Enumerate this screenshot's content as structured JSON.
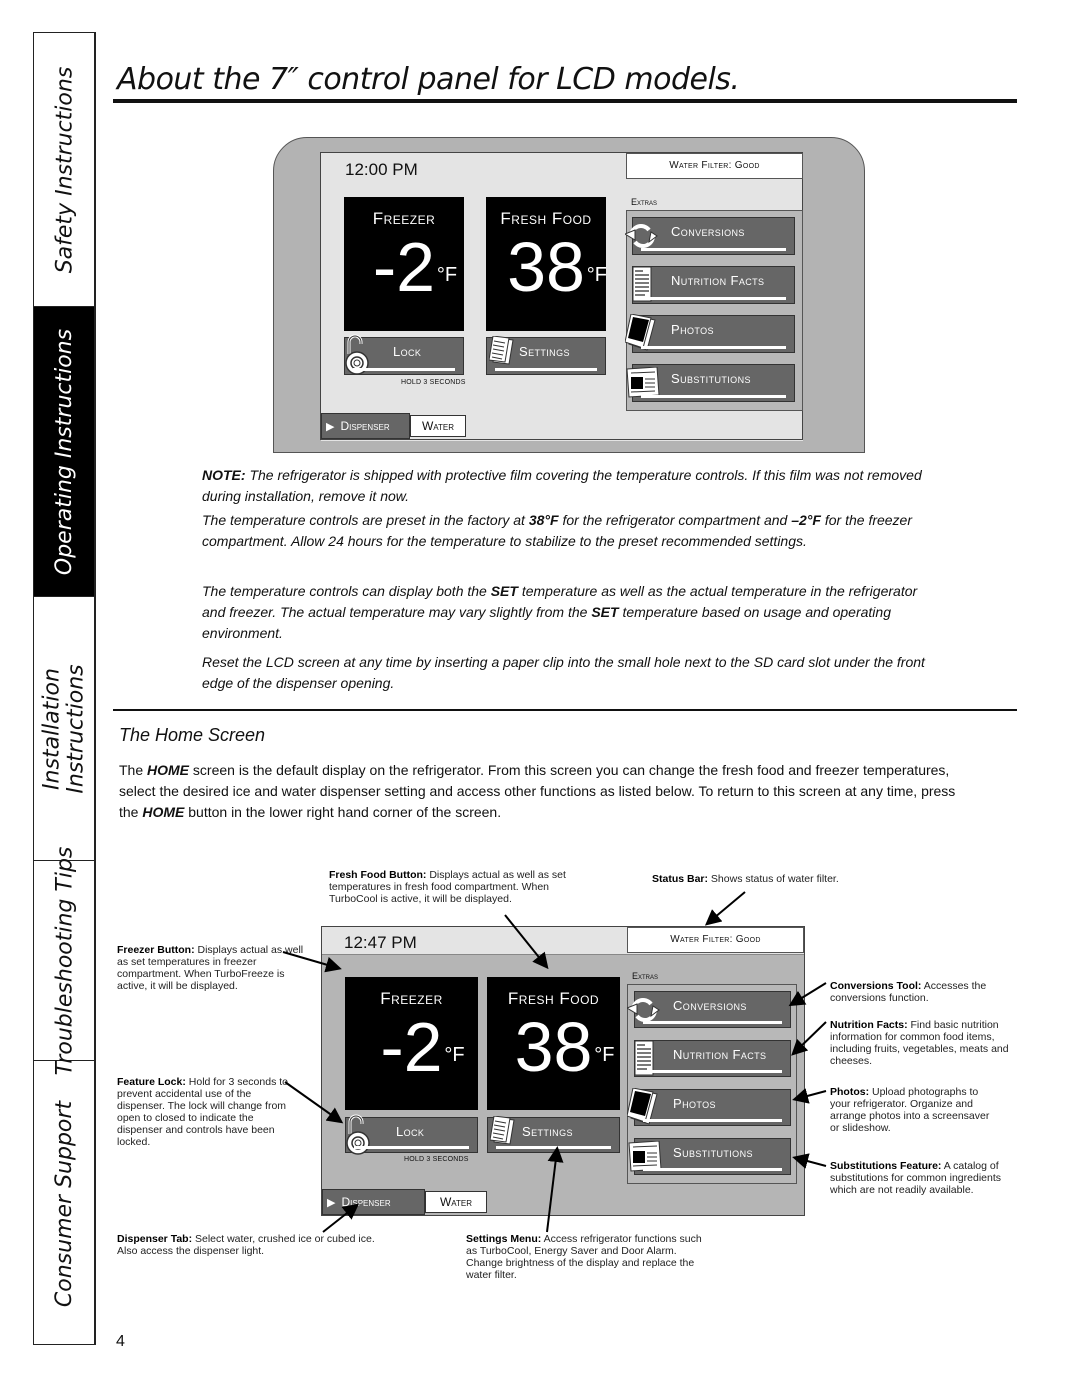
{
  "sidebar": {
    "tabs": [
      {
        "label": "Safety Instructions",
        "active": false
      },
      {
        "label": "Operating Instructions",
        "active": true
      },
      {
        "label_line1": "Installation",
        "label_line2": "Instructions",
        "active": false
      },
      {
        "label": "Troubleshooting Tips",
        "active": false
      },
      {
        "label": "Consumer Support",
        "active": false
      }
    ]
  },
  "page": {
    "title": "About the 7″ control panel for LCD models.",
    "page_number": "4"
  },
  "panel_top": {
    "time": "12:00 PM",
    "water_filter_status": "Water Filter: Good",
    "freezer": {
      "label": "Freezer",
      "value": "-2",
      "unit": "°F"
    },
    "fresh_food": {
      "label": "Fresh Food",
      "value": "38",
      "unit": "°F"
    },
    "lock_label": "Lock",
    "lock_hint": "HOLD 3 SECONDS",
    "settings_label": "Settings",
    "extras_label": "Extras",
    "extras": [
      {
        "label": "Conversions",
        "icon": "refresh-arrows-icon"
      },
      {
        "label": "Nutrition Facts",
        "icon": "nutrition-label-icon"
      },
      {
        "label": "Photos",
        "icon": "photos-icon"
      },
      {
        "label": "Substitutions",
        "icon": "document-icon"
      }
    ],
    "dispenser_label": "Dispenser",
    "dispenser_value": "Water"
  },
  "notes": {
    "note_prefix": "NOTE:",
    "note_text": " The refrigerator is shipped with protective film covering the temperature controls. If this film was not removed during installation, remove it now.",
    "preset_1": "The temperature controls are preset in the factory at ",
    "preset_fresh": "38°F",
    "preset_2": " for the refrigerator compartment and ",
    "preset_freezer": "–2°F",
    "preset_3": " for the freezer compartment. Allow 24 hours for the temperature to stabilize to the preset recommended settings.",
    "set_1": "The temperature controls can display both the ",
    "set_bold": "SET",
    "set_2": " temperature as well as the actual temperature in the refrigerator and freezer. The actual temperature may vary slightly from the ",
    "set_3": " temperature based on usage and operating environment.",
    "reset": "Reset the LCD screen at any time by inserting a paper clip into the small hole next to the SD card slot under the front edge of the dispenser opening."
  },
  "home_screen": {
    "heading": "The Home Screen",
    "intro_1": "The ",
    "home_bold": "HOME",
    "intro_2": " screen is the default display on the refrigerator. From this screen you can change the fresh food and freezer temperatures, select the desired ice and water dispenser setting and access other functions as listed below. To return to this screen at any time, press the ",
    "intro_3": " button in the lower right hand corner of the screen."
  },
  "panel_bottom": {
    "time": "12:47 PM",
    "water_filter_status": "Water Filter: Good",
    "freezer": {
      "label": "Freezer",
      "value": "-2",
      "unit": "°F"
    },
    "fresh_food": {
      "label": "Fresh Food",
      "value": "38",
      "unit": "°F"
    },
    "lock_label": "Lock",
    "lock_hint": "HOLD 3 SECONDS",
    "settings_label": "Settings",
    "extras_label": "Extras",
    "extras": [
      {
        "label": "Conversions"
      },
      {
        "label": "Nutrition Facts"
      },
      {
        "label": "Photos"
      },
      {
        "label": "Substitutions"
      }
    ],
    "dispenser_label": "Dispenser",
    "dispenser_value": "Water"
  },
  "callouts": {
    "fresh_food": {
      "title": "Fresh Food Button:",
      "text": " Displays actual as well as set temperatures in fresh food compartment. When TurboCool is active, it will be displayed."
    },
    "status_bar": {
      "title": "Status Bar:",
      "text": " Shows status of water filter."
    },
    "freezer": {
      "title": "Freezer Button:",
      "text": " Displays actual as well as set temperatures in freezer compartment. When TurboFreeze is active, it will be displayed."
    },
    "feature_lock": {
      "title": "Feature Lock:",
      "text": " Hold for 3 seconds to prevent accidental use of the dispenser. The lock will change from open to closed to indicate the dispenser and controls have been locked."
    },
    "dispenser_tab": {
      "title": "Dispenser Tab:",
      "text": " Select water, crushed ice or cubed ice. Also access the dispenser light."
    },
    "settings_menu": {
      "title": "Settings Menu:",
      "text": " Access refrigerator functions such as TurboCool, Energy Saver and Door Alarm. Change brightness of the display and replace the water filter."
    },
    "conversions": {
      "title": "Conversions Tool:",
      "text": " Accesses the conversions function."
    },
    "nutrition": {
      "title": "Nutrition Facts:",
      "text": " Find basic nutrition information for common food items, including fruits, vegetables, meats and cheeses."
    },
    "photos": {
      "title": "Photos:",
      "text": " Upload photographs to your refrigerator. Organize and arrange photos into a screensaver or slideshow."
    },
    "substitutions": {
      "title": "Substitutions Feature:",
      "text": " A catalog of substitutions for common ingredients which are not readily available."
    }
  }
}
